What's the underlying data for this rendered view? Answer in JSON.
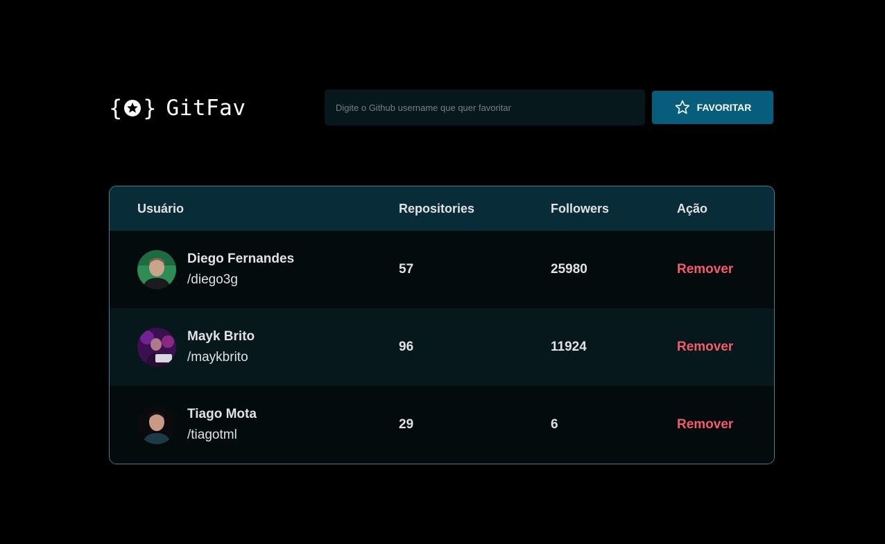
{
  "logo": {
    "text": "GitFav",
    "icon": "star-braces-icon"
  },
  "search": {
    "placeholder": "Digite o Github username que quer favoritar",
    "value": ""
  },
  "favorite_button": {
    "label": "FAVORITAR",
    "icon": "star-outline-icon"
  },
  "table": {
    "headers": {
      "user": "Usuário",
      "repositories": "Repositories",
      "followers": "Followers",
      "action": "Ação"
    },
    "rows": [
      {
        "name": "Diego Fernandes",
        "login": "/diego3g",
        "repositories": "57",
        "followers": "25980",
        "action": "Remover"
      },
      {
        "name": "Mayk Brito",
        "login": "/maykbrito",
        "repositories": "96",
        "followers": "11924",
        "action": "Remover"
      },
      {
        "name": "Tiago Mota",
        "login": "/tiagotml",
        "repositories": "29",
        "followers": "6",
        "action": "Remover"
      }
    ]
  },
  "colors": {
    "background": "#000000",
    "input_background": "#06181C",
    "button": "#065E7C",
    "table_header": "#092D38",
    "row_odd": "#030B0D",
    "row_even": "#06181C",
    "border": "#4A808C",
    "remove_text": "#F75A68"
  }
}
